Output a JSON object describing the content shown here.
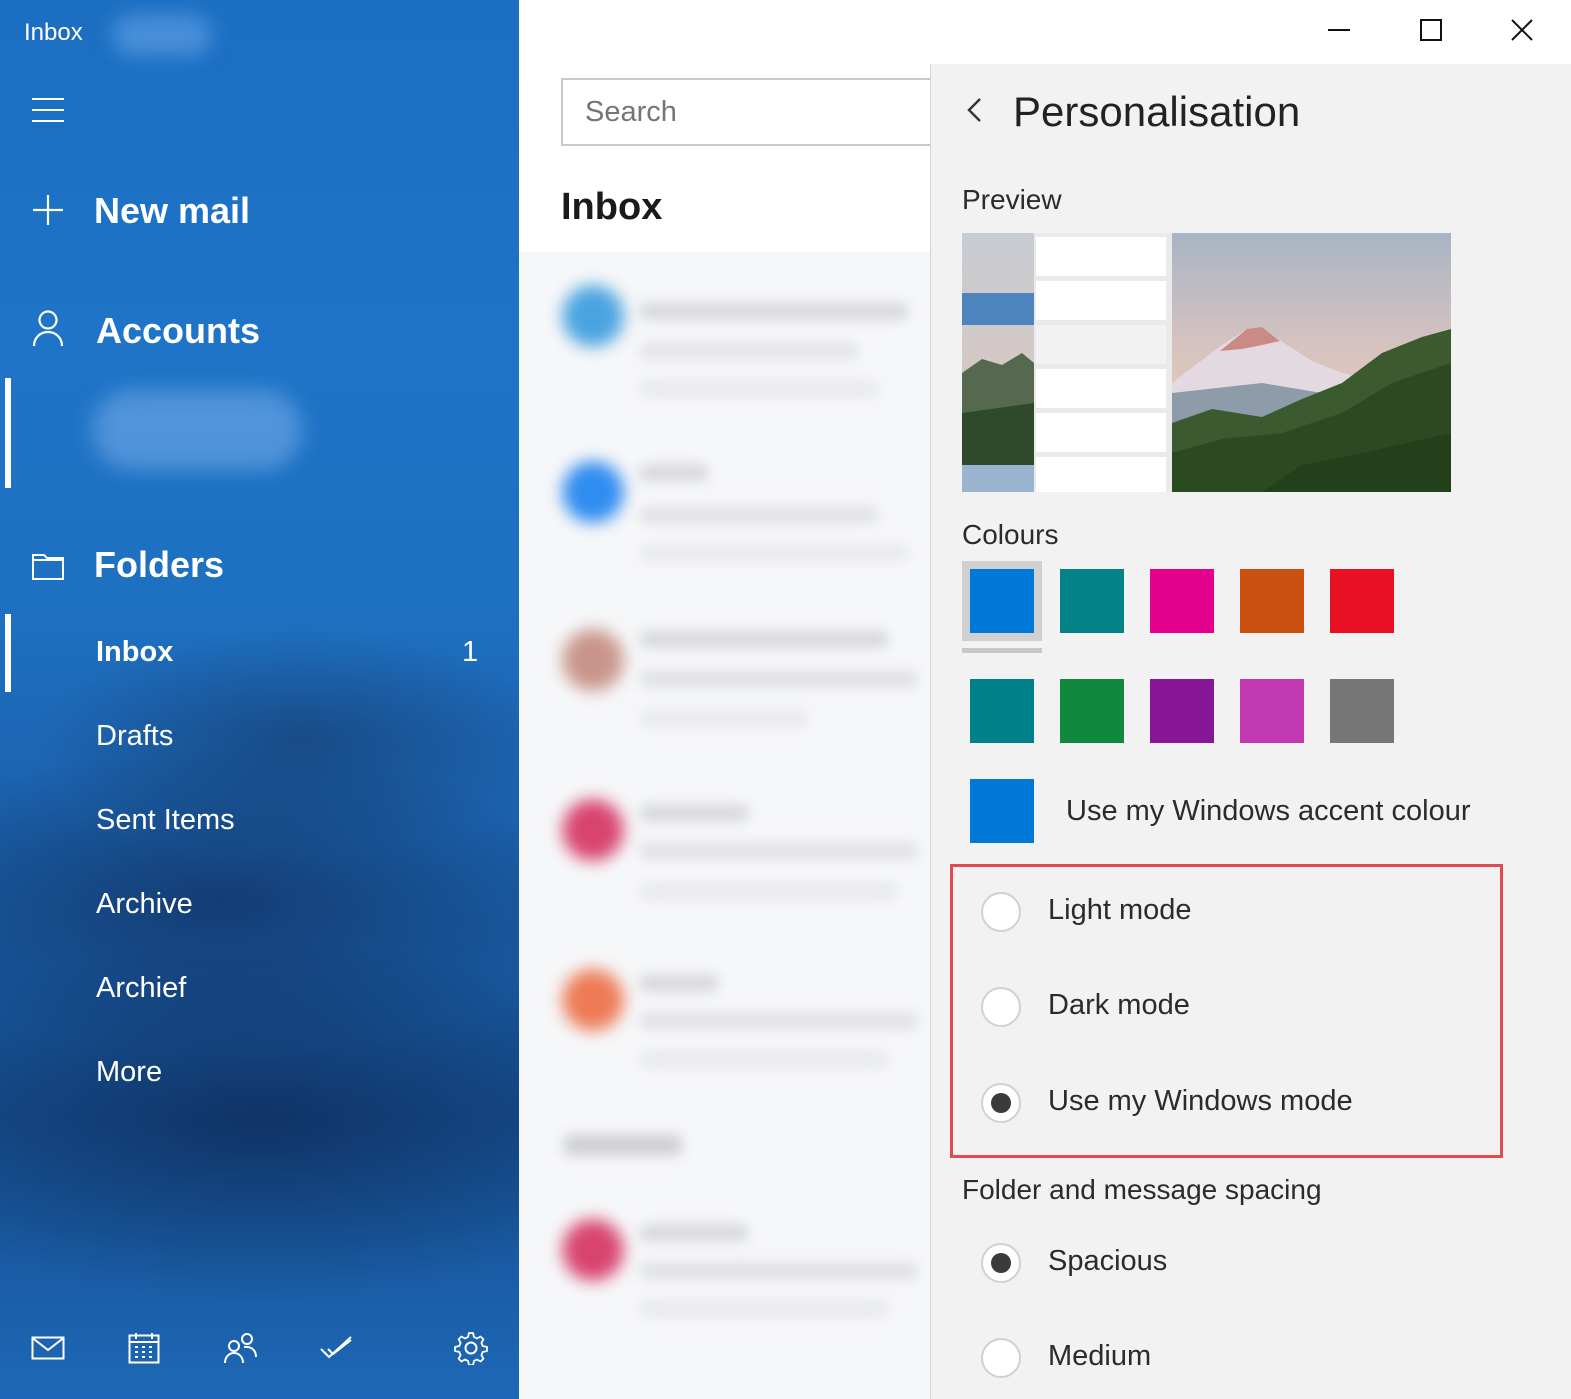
{
  "window": {
    "title": "Inbox"
  },
  "nav": {
    "new_mail": "New mail",
    "accounts": "Accounts",
    "folders_header": "Folders",
    "folders": [
      {
        "label": "Inbox",
        "count": "1"
      },
      {
        "label": "Drafts",
        "count": ""
      },
      {
        "label": "Sent Items",
        "count": ""
      },
      {
        "label": "Archive",
        "count": ""
      },
      {
        "label": "Archief",
        "count": ""
      },
      {
        "label": "More",
        "count": ""
      }
    ],
    "bottom_icons": [
      "mail-icon",
      "calendar-icon",
      "people-icon",
      "todo-icon",
      "settings-icon"
    ]
  },
  "list": {
    "search_placeholder": "Search",
    "title": "Inbox",
    "avatar_colors": [
      "#4aa3e0",
      "#2f8cf0",
      "#c9958a",
      "#d8436f",
      "#ee7a55",
      "#d8436f"
    ]
  },
  "titlebar": {
    "buttons": [
      "minimize-icon",
      "maximize-icon",
      "close-icon"
    ]
  },
  "personalisation": {
    "title": "Personalisation",
    "preview_label": "Preview",
    "colours_label": "Colours",
    "colours": [
      "#0078d7",
      "#038387",
      "#e3008c",
      "#ca5010",
      "#e81123",
      "#00818a",
      "#10893e",
      "#881798",
      "#c239b3",
      "#767676"
    ],
    "selected_colour": "#0078d7",
    "accent_option": {
      "label": "Use my Windows accent colour",
      "colour": "#0078d7"
    },
    "mode_options": [
      {
        "label": "Light mode",
        "selected": false
      },
      {
        "label": "Dark mode",
        "selected": false
      },
      {
        "label": "Use my Windows mode",
        "selected": true
      }
    ],
    "spacing_label": "Folder and message spacing",
    "spacing_options": [
      {
        "label": "Spacious",
        "selected": true
      },
      {
        "label": "Medium",
        "selected": false
      }
    ]
  }
}
